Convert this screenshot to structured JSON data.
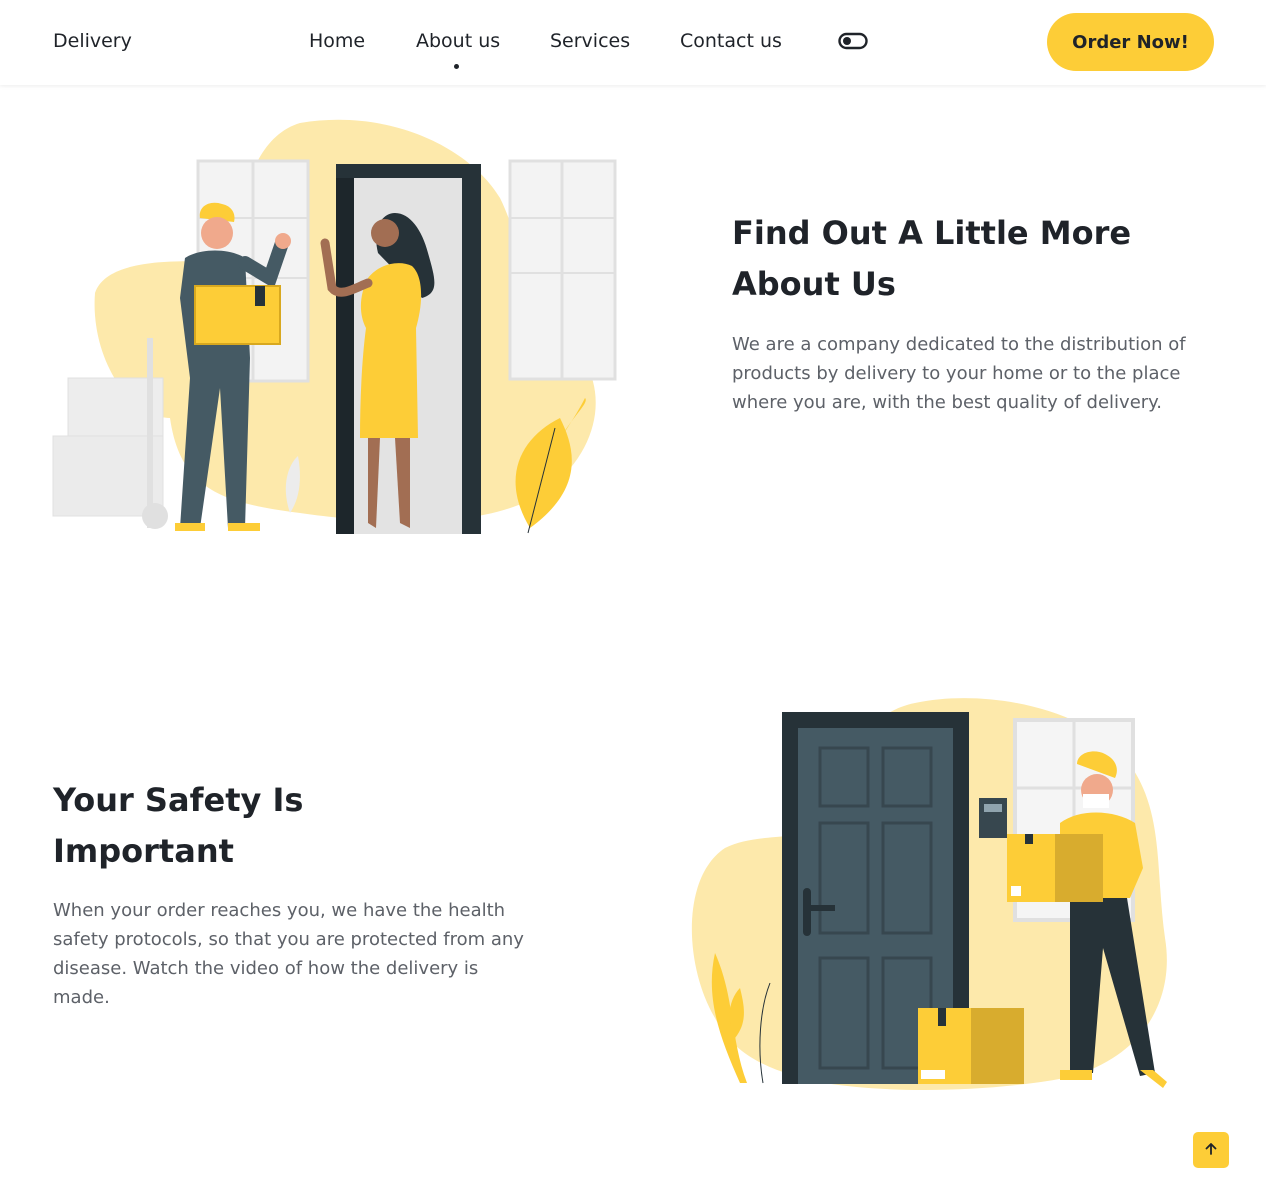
{
  "header": {
    "logo": "Delivery",
    "nav": [
      {
        "label": "Home"
      },
      {
        "label": "About us",
        "active": true
      },
      {
        "label": "Services"
      },
      {
        "label": "Contact us"
      }
    ],
    "order_button": "Order Now!",
    "toggle_icon": "theme-toggle-icon"
  },
  "about": {
    "title_line1": "Find Out A Little More",
    "title_line2": "About Us",
    "description": "We are a company dedicated to the distribution of products by delivery to your home or to the place where you are, with the best quality of delivery."
  },
  "safety": {
    "title_line1": "Your Safety Is",
    "title_line2": "Important",
    "description": "When your order reaches you, we have the health safety protocols, so that you are protected from any disease. Watch the video of how the delivery is made."
  },
  "scroll_top_icon": "arrow-up-icon",
  "colors": {
    "accent": "#fdcd37",
    "accent_light": "#fde9ab",
    "dark": "#263238",
    "text": "#1f2329",
    "muted": "#5d6168"
  }
}
